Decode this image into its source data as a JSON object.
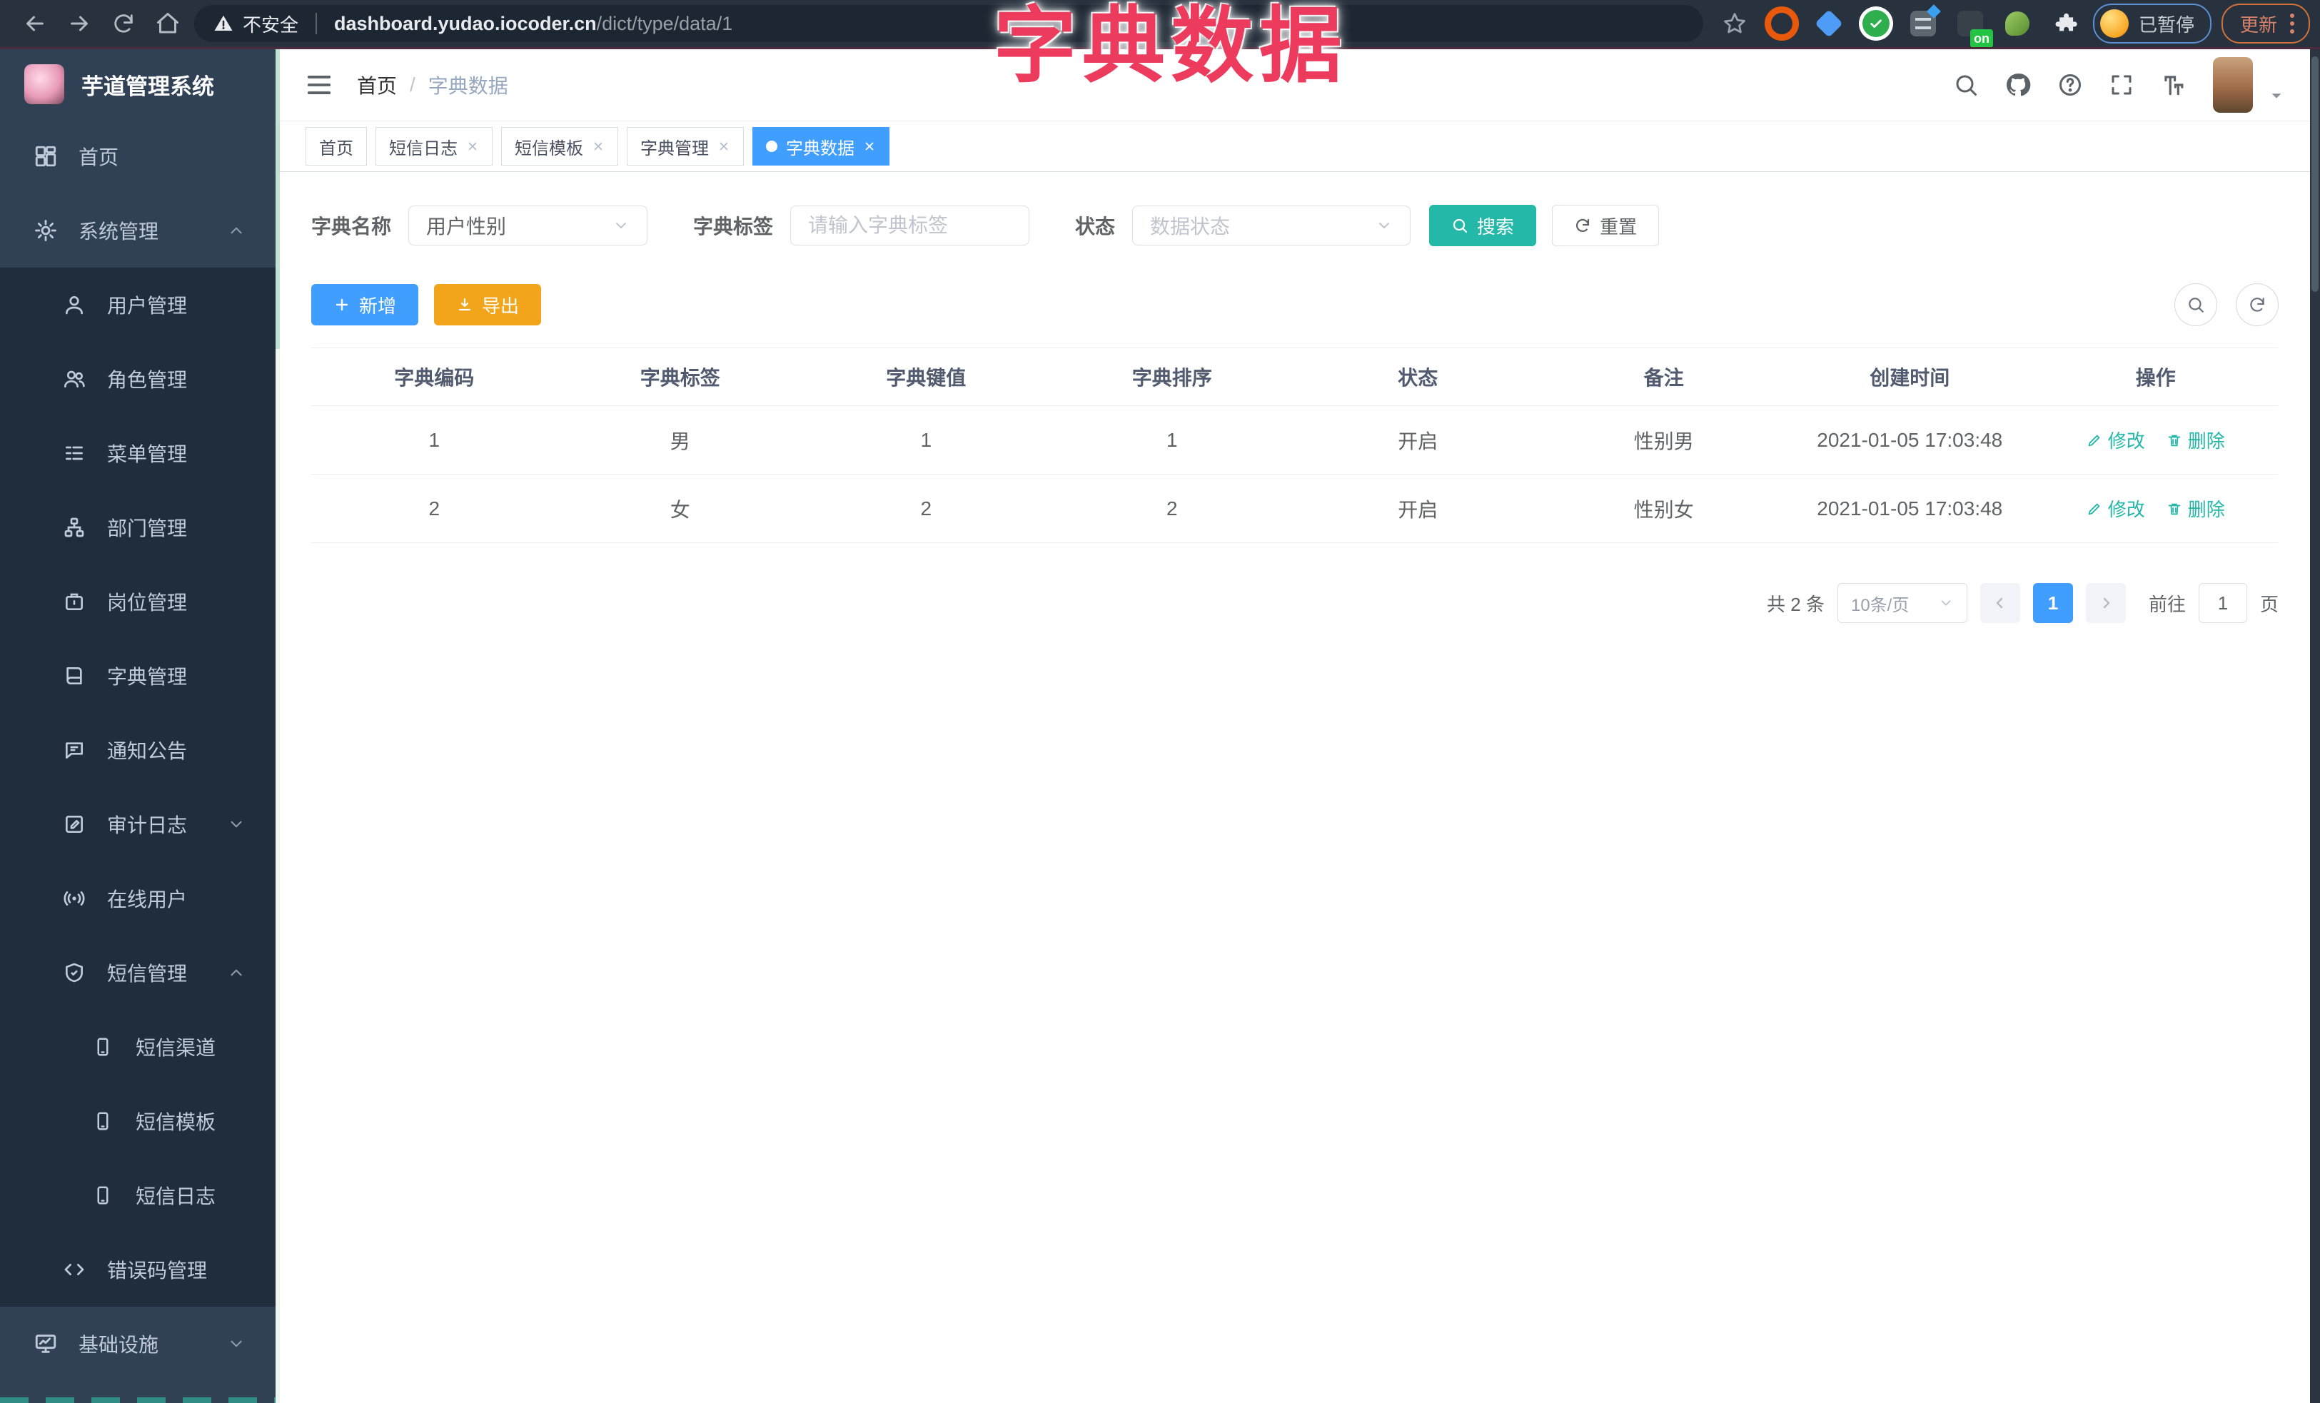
{
  "browser": {
    "security_label": "不安全",
    "url_domain": "dashboard.yudao.iocoder.cn",
    "url_path": "/dict/type/data/1",
    "on_badge_label": "on",
    "paused_label": "已暂停",
    "update_label": "更新"
  },
  "annotation": {
    "title": "字典数据"
  },
  "sidebar": {
    "logo_title": "芋道管理系统",
    "items": [
      {
        "label": "首页",
        "icon": "dashboard-icon",
        "level": 1
      },
      {
        "label": "系统管理",
        "icon": "gear-icon",
        "level": 1,
        "expanded": true
      },
      {
        "label": "用户管理",
        "icon": "user-icon",
        "level": 2
      },
      {
        "label": "角色管理",
        "icon": "users-icon",
        "level": 2
      },
      {
        "label": "菜单管理",
        "icon": "list-icon",
        "level": 2
      },
      {
        "label": "部门管理",
        "icon": "org-tree-icon",
        "level": 2
      },
      {
        "label": "岗位管理",
        "icon": "briefcase-icon",
        "level": 2
      },
      {
        "label": "字典管理",
        "icon": "book-icon",
        "level": 2
      },
      {
        "label": "通知公告",
        "icon": "announcement-icon",
        "level": 2
      },
      {
        "label": "审计日志",
        "icon": "audit-log-icon",
        "level": 2,
        "collapsed": true
      },
      {
        "label": "在线用户",
        "icon": "online-users-icon",
        "level": 2
      },
      {
        "label": "短信管理",
        "icon": "shield-check-icon",
        "level": 2,
        "expanded": true
      },
      {
        "label": "短信渠道",
        "icon": "phone-icon",
        "level": 3
      },
      {
        "label": "短信模板",
        "icon": "phone-icon",
        "level": 3
      },
      {
        "label": "短信日志",
        "icon": "phone-icon",
        "level": 3
      },
      {
        "label": "错误码管理",
        "icon": "code-icon",
        "level": 2
      },
      {
        "label": "基础设施",
        "icon": "monitor-icon",
        "level": 1,
        "collapsed": true
      }
    ]
  },
  "navbar": {
    "breadcrumb_home": "首页",
    "breadcrumb_sep": "/",
    "breadcrumb_current": "字典数据"
  },
  "tabs": [
    {
      "label": "首页",
      "closable": false,
      "active": false
    },
    {
      "label": "短信日志",
      "closable": true,
      "active": false
    },
    {
      "label": "短信模板",
      "closable": true,
      "active": false
    },
    {
      "label": "字典管理",
      "closable": true,
      "active": false
    },
    {
      "label": "字典数据",
      "closable": true,
      "active": true
    }
  ],
  "filter": {
    "dict_name_label": "字典名称",
    "dict_name_value": "用户性别",
    "dict_label_label": "字典标签",
    "dict_label_placeholder": "请输入字典标签",
    "status_label": "状态",
    "status_placeholder": "数据状态",
    "search_label": "搜索",
    "reset_label": "重置"
  },
  "toolbar": {
    "add_label": "新增",
    "export_label": "导出"
  },
  "table": {
    "headers": [
      "字典编码",
      "字典标签",
      "字典键值",
      "字典排序",
      "状态",
      "备注",
      "创建时间",
      "操作"
    ],
    "edit_label": "修改",
    "delete_label": "删除",
    "rows": [
      {
        "code": "1",
        "label": "男",
        "value": "1",
        "sort": "1",
        "status": "开启",
        "remark": "性别男",
        "created_at": "2021-01-05 17:03:48"
      },
      {
        "code": "2",
        "label": "女",
        "value": "2",
        "sort": "2",
        "status": "开启",
        "remark": "性别女",
        "created_at": "2021-01-05 17:03:48"
      }
    ]
  },
  "pagination": {
    "total_label": "共 2 条",
    "page_size_value": "10条/页",
    "current_page": "1",
    "goto_label": "前往",
    "goto_value": "1",
    "page_unit": "页"
  },
  "icons": {
    "search-icon": "magnifier",
    "gear-icon": "cogwheel",
    "github-icon": "octocat",
    "help-icon": "question-circle",
    "fullscreen-icon": "expand-corners",
    "font-size-icon": "tT",
    "warning-icon": "triangle-exclamation",
    "puzzle-icon": "extension-puzzle"
  },
  "colors": {
    "primary": "#409eff",
    "teal": "#23b8a8",
    "warning": "#f2a51a",
    "annotation_red": "#ec3b5d",
    "sidebar_bg": "#304156",
    "submenu_bg": "#1f2d3d",
    "chrome_bg": "#28323e"
  }
}
